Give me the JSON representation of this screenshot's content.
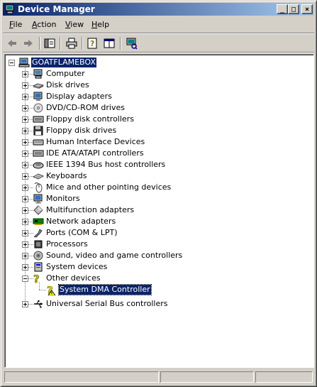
{
  "window": {
    "title": "Device Manager",
    "buttons": {
      "minimize": "_",
      "maximize": "□",
      "close": "×"
    }
  },
  "menu": [
    {
      "label": "File",
      "accel": "F",
      "rest": "ile"
    },
    {
      "label": "Action",
      "accel": "A",
      "rest": "ction"
    },
    {
      "label": "View",
      "accel": "V",
      "rest": "iew"
    },
    {
      "label": "Help",
      "accel": "H",
      "rest": "elp"
    }
  ],
  "toolbar": {
    "icons": [
      "back-arrow-icon",
      "forward-arrow-icon",
      "show-hide-tree-icon",
      "print-icon",
      "properties-help-icon",
      "export-list-icon",
      "scan-hardware-icon"
    ]
  },
  "tree": {
    "root": "GOATFLAMEBOX",
    "items": [
      {
        "label": "Computer",
        "icon": "computer-icon"
      },
      {
        "label": "Disk drives",
        "icon": "disk-drive-icon"
      },
      {
        "label": "Display adapters",
        "icon": "display-adapter-icon"
      },
      {
        "label": "DVD/CD-ROM drives",
        "icon": "cd-drive-icon"
      },
      {
        "label": "Floppy disk controllers",
        "icon": "controller-icon"
      },
      {
        "label": "Floppy disk drives",
        "icon": "floppy-icon"
      },
      {
        "label": "Human Interface Devices",
        "icon": "hid-icon"
      },
      {
        "label": "IDE ATA/ATAPI controllers",
        "icon": "controller-icon"
      },
      {
        "label": "IEEE 1394 Bus host controllers",
        "icon": "firewire-icon"
      },
      {
        "label": "Keyboards",
        "icon": "keyboard-icon"
      },
      {
        "label": "Mice and other pointing devices",
        "icon": "mouse-icon"
      },
      {
        "label": "Monitors",
        "icon": "monitor-icon"
      },
      {
        "label": "Multifunction adapters",
        "icon": "multifunction-icon"
      },
      {
        "label": "Network adapters",
        "icon": "network-icon"
      },
      {
        "label": "Ports (COM & LPT)",
        "icon": "port-icon"
      },
      {
        "label": "Processors",
        "icon": "processor-icon"
      },
      {
        "label": "Sound, video and game controllers",
        "icon": "sound-icon"
      },
      {
        "label": "System devices",
        "icon": "system-icon"
      }
    ],
    "other": {
      "label": "Other devices",
      "child": "System DMA Controller"
    },
    "last": "Universal Serial Bus controllers"
  }
}
